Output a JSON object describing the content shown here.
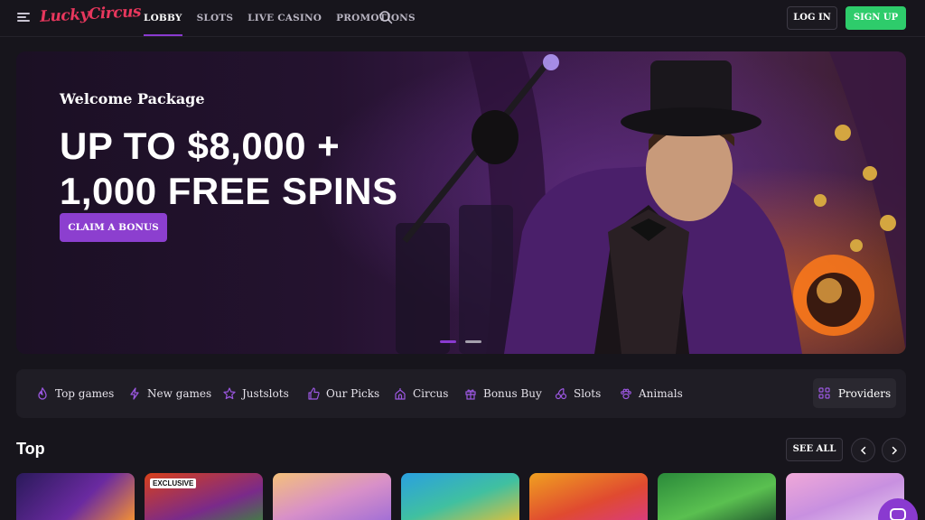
{
  "brand": {
    "logo_text": "LuckyCircus"
  },
  "nav": {
    "items": [
      {
        "label": "LOBBY",
        "active": true
      },
      {
        "label": "SLOTS",
        "active": false
      },
      {
        "label": "LIVE CASINO",
        "active": false
      },
      {
        "label": "PROMOTIONS",
        "active": false
      }
    ]
  },
  "auth": {
    "login_label": "LOG IN",
    "signup_label": "SIGN UP"
  },
  "hero": {
    "subtitle": "Welcome Package",
    "title_line1": "UP TO $8,000 +",
    "title_line2": "1,000 FREE SPINS",
    "cta_label": "CLAIM A BONUS",
    "slides": 2,
    "active_slide": 1
  },
  "categories": [
    {
      "label": "Top games",
      "icon": "flame-icon"
    },
    {
      "label": "New games",
      "icon": "lightning-icon"
    },
    {
      "label": "Justslots",
      "icon": "star-icon"
    },
    {
      "label": "Our Picks",
      "icon": "thumbs-up-icon"
    },
    {
      "label": "Circus",
      "icon": "circus-tent-icon"
    },
    {
      "label": "Bonus Buy",
      "icon": "gift-icon"
    },
    {
      "label": "Slots",
      "icon": "cherries-icon"
    },
    {
      "label": "Animals",
      "icon": "paw-icon"
    }
  ],
  "providers_label": "Providers",
  "top_section": {
    "title": "Top",
    "see_all_label": "SEE ALL",
    "tiles": [
      {
        "badge": ""
      },
      {
        "badge": "EXCLUSIVE"
      },
      {
        "badge": ""
      },
      {
        "badge": ""
      },
      {
        "badge": ""
      },
      {
        "badge": ""
      },
      {
        "badge": ""
      }
    ]
  },
  "colors": {
    "accent": "#8a3ad0",
    "signup_green": "#2ecc6b",
    "logo_pink": "#e8375d",
    "background": "#17151c"
  }
}
